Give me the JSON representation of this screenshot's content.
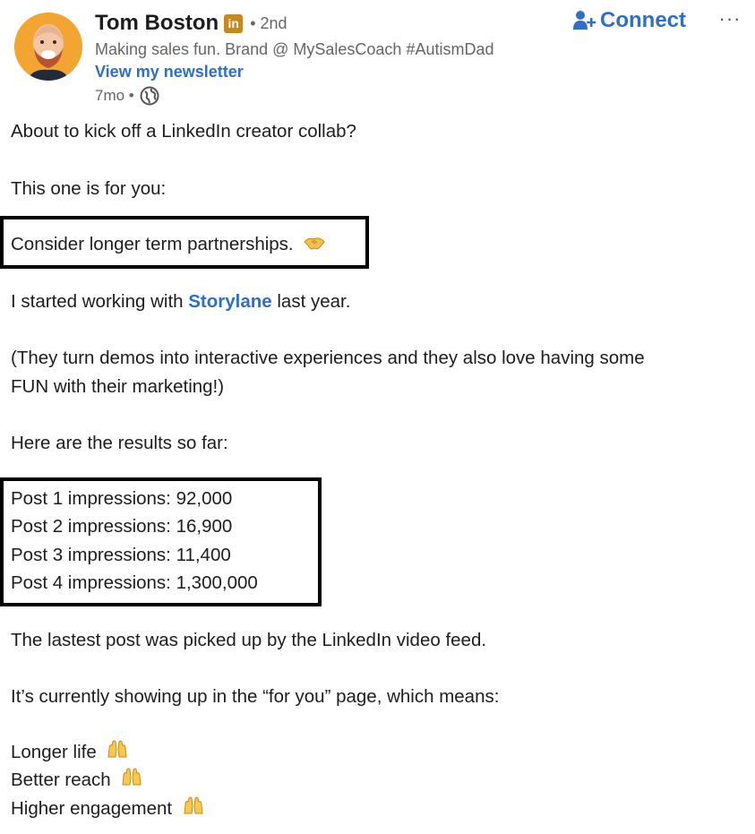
{
  "post": {
    "author": {
      "name": "Tom Boston",
      "badge": "in",
      "degree": "• 2nd",
      "headline": "Making sales fun. Brand @ MySalesCoach #AutismDad",
      "newsletter": "View my newsletter",
      "time": "7mo •",
      "avatar_color": "#f2a531"
    },
    "actions": {
      "connect": "Connect",
      "more": "···"
    },
    "lines": {
      "intro": "About to kick off a LinkedIn creator collab?",
      "for_you": "This one is for you:",
      "consider": "Consider longer term partnerships.",
      "started_pre": "I started working with ",
      "started_link": "Storylane",
      "started_post": " last year.",
      "paren_1": "(They turn demos into interactive experiences and they also love having some",
      "paren_2": "FUN with their marketing!)",
      "results": "Here are the results so far:",
      "post1": "Post 1 impressions: 92,000",
      "post2": "Post 2 impressions: 16,900",
      "post3": "Post 3 impressions: 11,400",
      "post4": "Post 4 impressions: 1,300,000",
      "lastest": "The lastest post was picked up by the LinkedIn video feed.",
      "showing": "It’s currently showing up in the “for you” page, which means:",
      "longer": "Longer life",
      "better": "Better reach",
      "higher": "Higher engagement"
    },
    "colors": {
      "link": "#2f6fc4",
      "text": "#1d1d1d",
      "muted": "#666666",
      "linkedin_badge": "#c8891c"
    },
    "icons": {
      "handshake": "handshake-emoji",
      "raising_hands": "raising-hands-emoji",
      "globe": "globe-icon",
      "add_person": "add-person-icon"
    }
  }
}
